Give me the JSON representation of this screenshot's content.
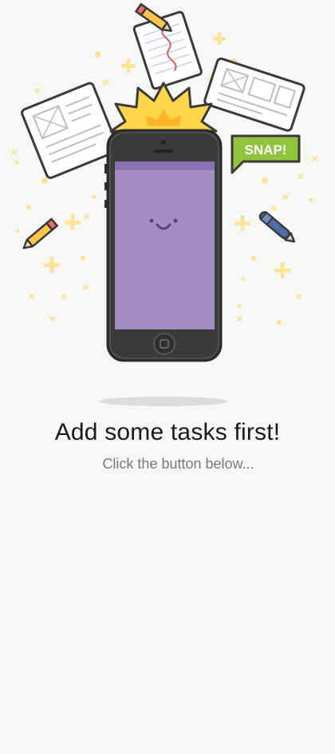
{
  "empty_state": {
    "title": "Add some tasks first!",
    "subtitle": "Click the button below...",
    "badge_text": "SNAP!"
  },
  "colors": {
    "background": "#f7f7f5",
    "screen_purple": "#a48dc2",
    "screen_top_bar": "#8a70b0",
    "star_yellow": "#ffd54a",
    "snap_green": "#8fc43f",
    "sparkle_yellow": "#fde29a"
  },
  "icons": [
    "phone-icon",
    "smiley-face-icon",
    "star-burst-icon",
    "pencil-icon",
    "pen-icon",
    "paper-sheet-icon",
    "sparkle-icon"
  ]
}
